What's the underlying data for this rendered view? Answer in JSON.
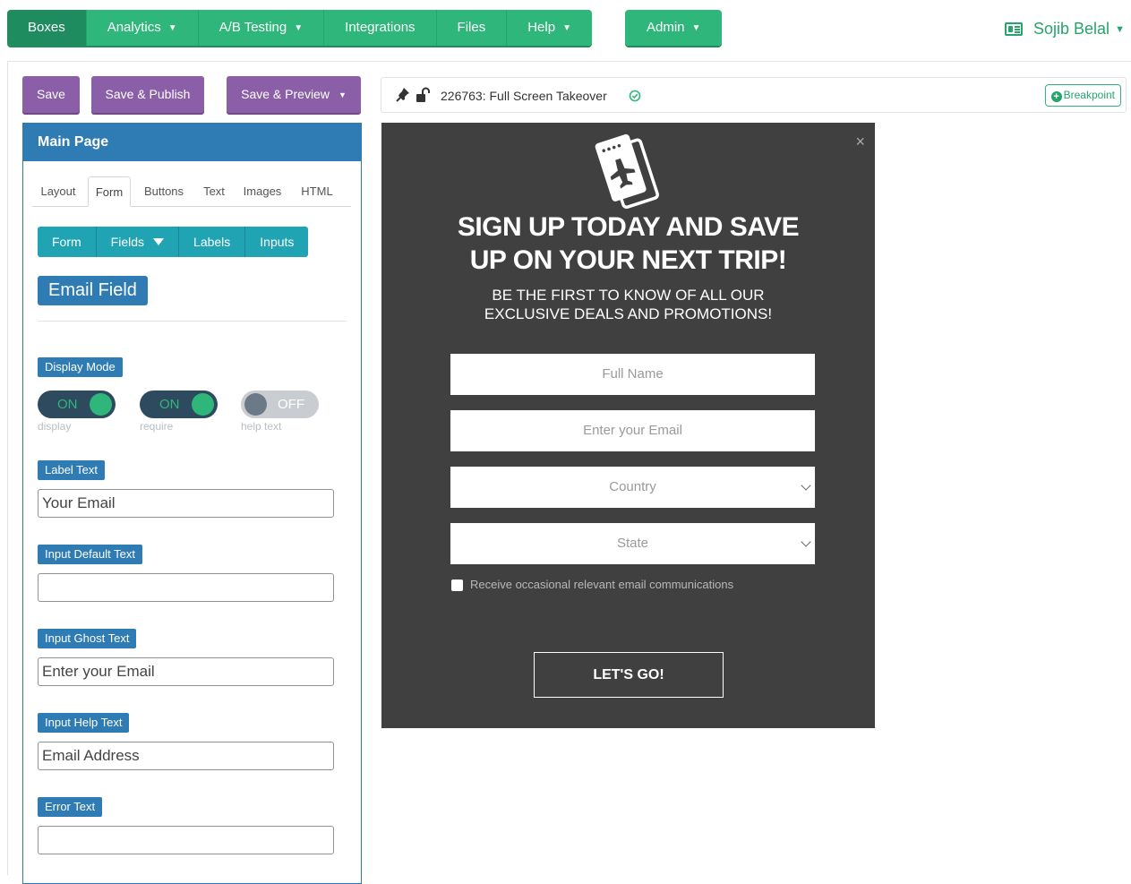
{
  "nav": {
    "items": [
      {
        "label": "Boxes",
        "active": true,
        "dropdown": false
      },
      {
        "label": "Analytics",
        "dropdown": true
      },
      {
        "label": "A/B Testing",
        "dropdown": true
      },
      {
        "label": "Integrations",
        "dropdown": false
      },
      {
        "label": "Files",
        "dropdown": false
      },
      {
        "label": "Help",
        "dropdown": true
      }
    ],
    "admin": "Admin",
    "user": "Sojib Belal",
    "icons": {
      "caret": "caret-down-icon",
      "user": "contact-card-icon"
    }
  },
  "toolbar": {
    "save": "Save",
    "save_publish": "Save & Publish",
    "save_preview": "Save & Preview"
  },
  "panel": {
    "title": "Main Page",
    "tabs": [
      "Layout",
      "Form",
      "Buttons",
      "Text",
      "Images",
      "HTML"
    ],
    "active_tab": "Form",
    "subtabs": [
      "Form",
      "Fields",
      "Labels",
      "Inputs"
    ],
    "field_title": "Email Field",
    "display_mode_label": "Display Mode",
    "toggles": [
      {
        "state": "ON",
        "caption": "display"
      },
      {
        "state": "ON",
        "caption": "require"
      },
      {
        "state": "OFF",
        "caption": "help text"
      }
    ],
    "label_text": {
      "label": "Label Text",
      "value": "Your Email"
    },
    "input_default": {
      "label": "Input Default Text",
      "value": ""
    },
    "input_ghost": {
      "label": "Input Ghost Text",
      "value": "Enter your Email"
    },
    "input_help": {
      "label": "Input Help Text",
      "value": "Email Address"
    },
    "error_text": {
      "label": "Error Text",
      "value": ""
    }
  },
  "preview": {
    "title": "226763: Full Screen Takeover",
    "breakpoint": "Breakpoint",
    "icons": [
      "pin-icon",
      "unlock-icon",
      "check-circle-icon"
    ]
  },
  "popup": {
    "close": "×",
    "headline_1": "SIGN UP TODAY AND SAVE",
    "headline_2": "UP ON YOUR NEXT TRIP!",
    "sub_1": "BE THE FIRST TO KNOW OF ALL OUR",
    "sub_2": "EXCLUSIVE DEALS AND PROMOTIONS!",
    "full_name": "Full Name",
    "email": "Enter your Email",
    "country": "Country",
    "state": "State",
    "consent": "Receive occasional relevant email communications",
    "cta": "LET'S GO!",
    "icon": "plane-ticket-icon"
  },
  "colors": {
    "green": "#2fb67a",
    "purple": "#8a5fa8",
    "blue": "#2f7bb3",
    "teal": "#20a3b3",
    "popup_bg": "#404040"
  }
}
